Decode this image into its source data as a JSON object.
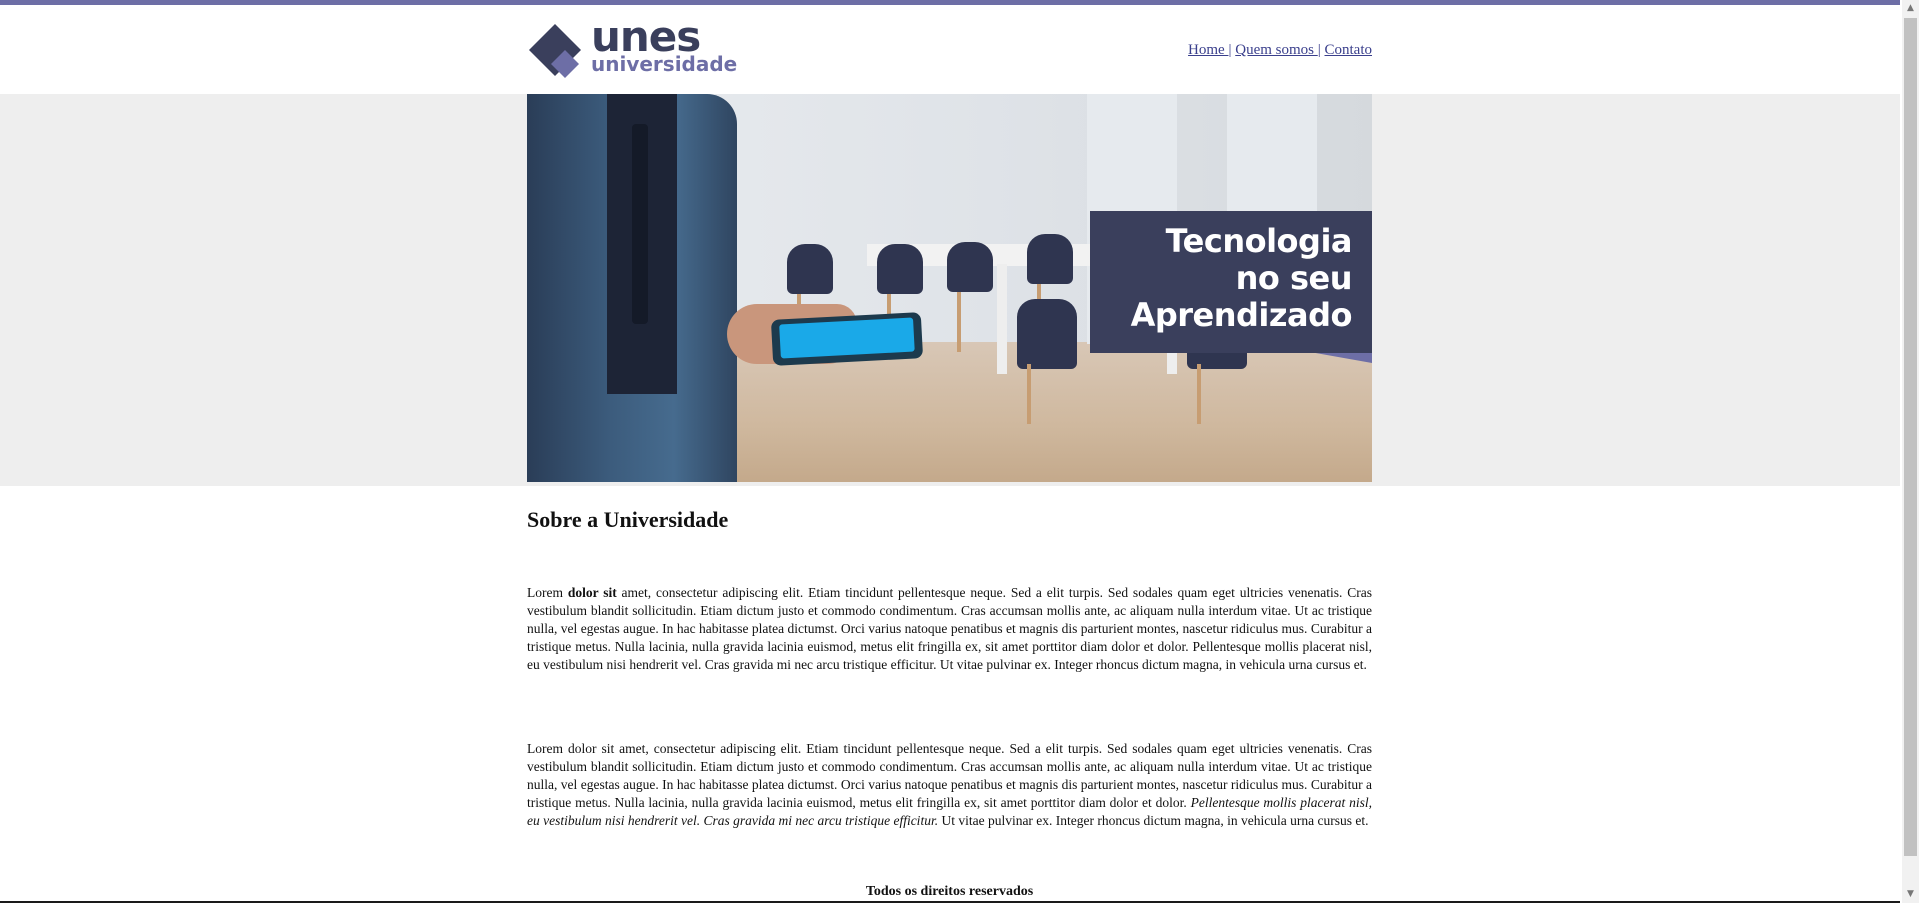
{
  "header": {
    "logo": {
      "word": "unes",
      "sub": "universidade"
    },
    "nav": [
      {
        "label": "Home "
      },
      {
        "label": "Quem somos "
      },
      {
        "label": "Contato"
      }
    ],
    "nav_separator": "|"
  },
  "hero": {
    "caption_lines": [
      "Tecnologia",
      "no seu",
      "Aprendizado"
    ]
  },
  "main": {
    "title": "Sobre a Universidade",
    "paragraph_1": {
      "before_bold": "Lorem ",
      "bold": "dolor sit",
      "after_bold": " amet, consectetur adipiscing elit. Etiam tincidunt pellentesque neque. Sed a elit turpis. Sed sodales quam eget ultricies venenatis. Cras vestibulum blandit sollicitudin. Etiam dictum justo et commodo condimentum. Cras accumsan mollis ante, ac aliquam nulla interdum vitae. Ut ac tristique nulla, vel egestas augue. In hac habitasse platea dictumst. Orci varius natoque penatibus et magnis dis parturient montes, nascetur ridiculus mus. Curabitur a tristique metus. Nulla lacinia, nulla gravida lacinia euismod, metus elit fringilla ex, sit amet porttitor diam dolor et dolor. Pellentesque mollis placerat nisl, eu vestibulum nisi hendrerit vel. Cras gravida mi nec arcu tristique efficitur. Ut vitae pulvinar ex. Integer rhoncus dictum magna, in vehicula urna cursus et."
    },
    "paragraph_2": {
      "before_italic": "Lorem dolor sit amet, consectetur adipiscing elit. Etiam tincidunt pellentesque neque. Sed a elit turpis. Sed sodales quam eget ultricies venenatis. Cras vestibulum blandit sollicitudin. Etiam dictum justo et commodo condimentum. Cras accumsan mollis ante, ac aliquam nulla interdum vitae. Ut ac tristique nulla, vel egestas augue. In hac habitasse platea dictumst. Orci varius natoque penatibus et magnis dis parturient montes, nascetur ridiculus mus. Curabitur a tristique metus. Nulla lacinia, nulla gravida lacinia euismod, metus elit fringilla ex, sit amet porttitor diam dolor et dolor. ",
      "italic": "Pellentesque mollis placerat nisl, eu vestibulum nisi hendrerit vel. Cras gravida mi nec arcu tristique efficitur.",
      "after_italic": " Ut vitae pulvinar ex. Integer rhoncus dictum magna, in vehicula urna cursus et."
    }
  },
  "footer": {
    "text": "Todos os direitos reservados"
  },
  "scrollbar": {
    "up_icon": "▲",
    "down_icon": "▼"
  },
  "colors": {
    "accent": "#6d6ea6",
    "brand_dark": "#3a3f5c",
    "hero_band": "#eeeeee",
    "link": "#3a3f8c"
  }
}
